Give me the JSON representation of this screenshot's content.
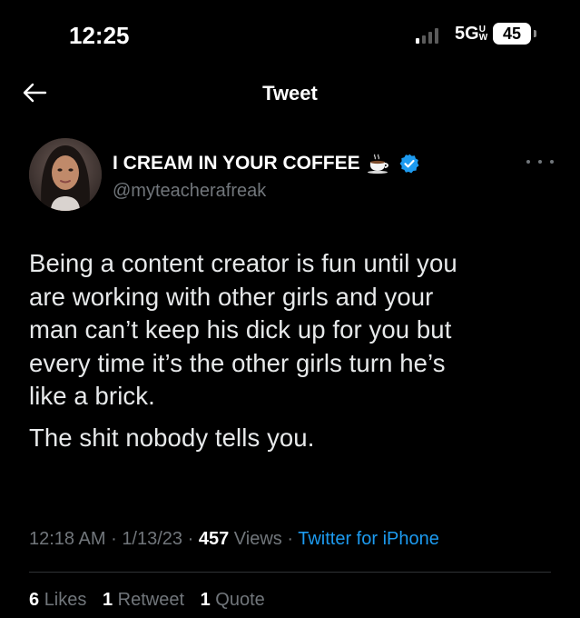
{
  "status_bar": {
    "time": "12:25",
    "network": "5G",
    "network_sub": "UW",
    "battery": "45"
  },
  "nav": {
    "title": "Tweet",
    "back_icon": "arrow-left-icon"
  },
  "tweet": {
    "display_name": "I CREAM IN YOUR COFFEE",
    "handle": "@myteacherafreak",
    "emoji_icon": "coffee-cup-icon",
    "verified_icon": "verified-badge-icon",
    "more_icon": "more-horizontal-icon",
    "paragraphs": [
      "Being a content creator is fun until you\nare  working with other girls and your\nman can’t keep his dick up for you but\nevery time it’s the other girls turn he’s\nlike a brick.",
      "The shit nobody tells you."
    ],
    "time": "12:18 AM",
    "date": "1/13/23",
    "views_count": "457",
    "views_label": "Views",
    "source": "Twitter for iPhone",
    "separator": "·"
  },
  "stats": {
    "likes_count": "6",
    "likes_label": "Likes",
    "retweets_count": "1",
    "retweets_label": "Retweet",
    "quotes_count": "1",
    "quotes_label": "Quote"
  },
  "colors": {
    "background": "#000000",
    "text": "#e7e9ea",
    "secondary": "#71767b",
    "link": "#1d9bf0"
  }
}
